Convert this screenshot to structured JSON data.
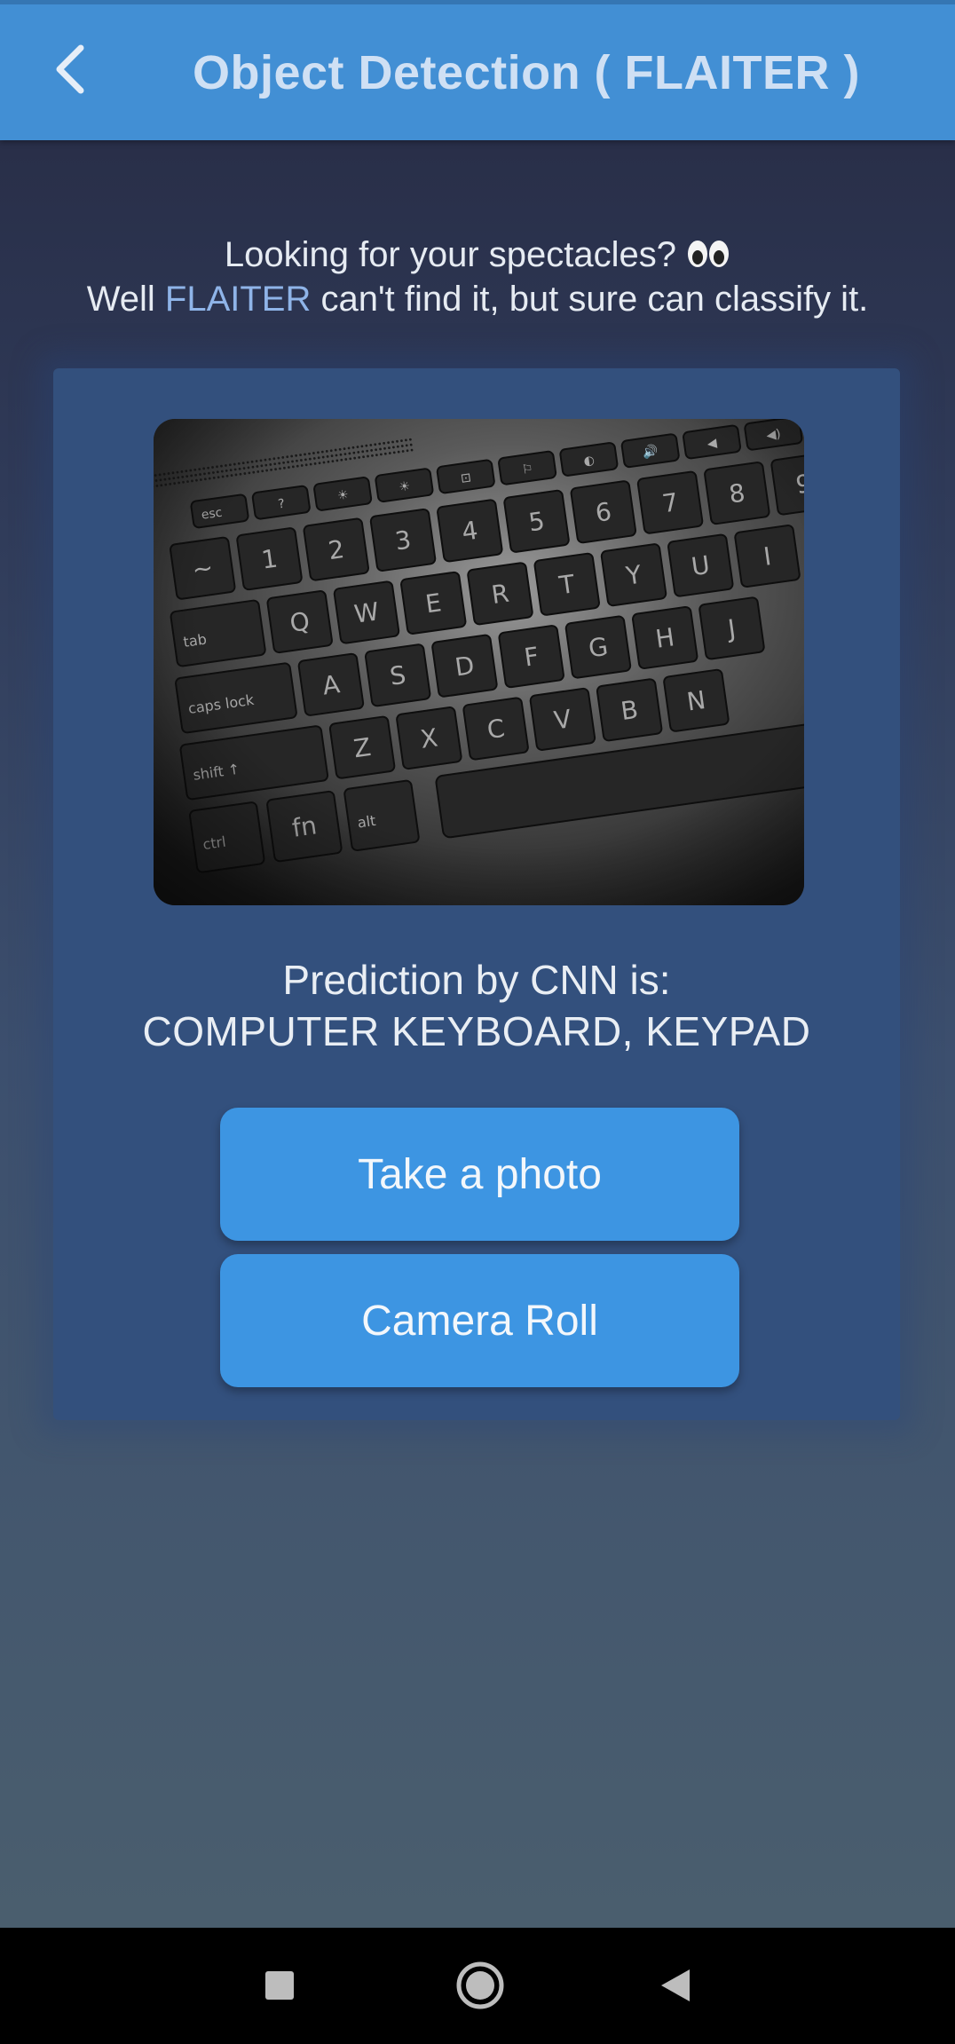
{
  "app_bar": {
    "title": "Object Detection ( FLAITER )",
    "back_icon": "chevron-left-icon"
  },
  "intro": {
    "line1": "Looking for your spectacles?",
    "line1_emoji": "eyes-icon",
    "line2_before": "Well",
    "line2_brand": "FLAITER",
    "line2_after": "can't find it, but sure can classify it."
  },
  "prediction": {
    "label": "Prediction by CNN is:",
    "value": "COMPUTER KEYBOARD, KEYPAD"
  },
  "buttons": {
    "take_photo": "Take a photo",
    "camera_roll": "Camera Roll"
  },
  "keyboard_keys": {
    "row_fn": [
      "esc",
      "?",
      "☀",
      "☀",
      "⊡",
      "⚐",
      "◐",
      "🔊",
      "◀",
      "◀)",
      "|◀◀"
    ],
    "row_num": [
      "~",
      "1",
      "2",
      "3",
      "4",
      "5",
      "6",
      "7",
      "8",
      "9"
    ],
    "row_q": [
      "tab",
      "Q",
      "W",
      "E",
      "R",
      "T",
      "Y",
      "U",
      "I"
    ],
    "row_a": [
      "caps lock",
      "A",
      "S",
      "D",
      "F",
      "G",
      "H",
      "J"
    ],
    "row_z": [
      "shift ↑",
      "Z",
      "X",
      "C",
      "V",
      "B",
      "N"
    ],
    "row_ctrl": [
      "ctrl",
      "fn",
      "alt"
    ]
  },
  "colors": {
    "app_bar": "#428fd4",
    "accent_text": "#8fb4e8",
    "button": "#3d95e2",
    "card": "#33507d"
  },
  "nav": {
    "recent_icon": "square-icon",
    "home_icon": "circle-home-icon",
    "back_icon": "triangle-back-icon"
  }
}
